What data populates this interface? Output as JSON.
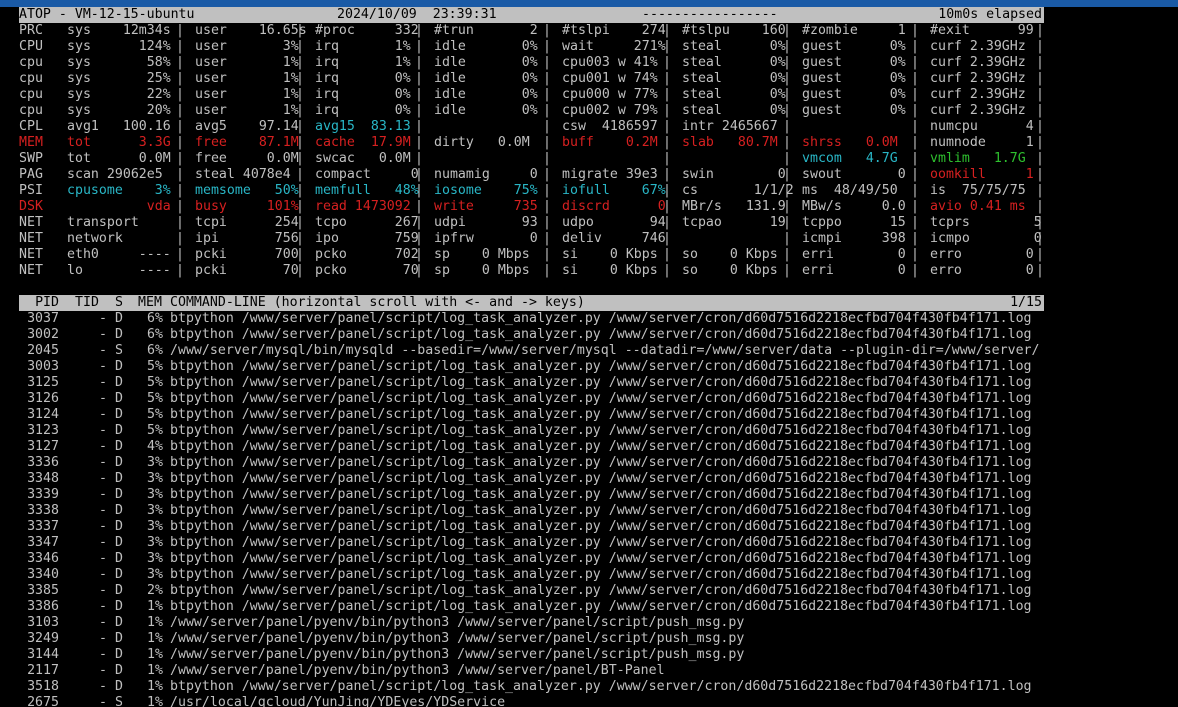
{
  "header": {
    "app": "ATOP - VM-12-15-ubuntu",
    "datetime": "2024/10/09  23:39:31",
    "dashes": "-----------------",
    "elapsed": "10m0s elapsed"
  },
  "stats": [
    {
      "cls": "",
      "label": "PRC",
      "cols": [
        {
          "t": "sys    12m34s"
        },
        {
          "t": "user    16.65s"
        },
        {
          "t": "#proc     332"
        },
        {
          "t": "#trun       2"
        },
        {
          "t": "#tslpi    274"
        },
        {
          "t": "#tslpu    160"
        },
        {
          "t": "#zombie     1"
        },
        {
          "t": "#exit      99"
        }
      ]
    },
    {
      "cls": "",
      "label": "CPU",
      "cols": [
        {
          "t": "sys      124%"
        },
        {
          "t": "user       3%"
        },
        {
          "t": "irq       1%"
        },
        {
          "t": "idle       0%"
        },
        {
          "t": "wait     271%"
        },
        {
          "t": "steal      0%"
        },
        {
          "t": "guest      0%"
        },
        {
          "t": "curf 2.39GHz"
        }
      ]
    },
    {
      "cls": "",
      "label": "cpu",
      "cols": [
        {
          "t": "sys       58%"
        },
        {
          "t": "user       1%"
        },
        {
          "t": "irq       1%"
        },
        {
          "t": "idle       0%"
        },
        {
          "t": "cpu003 w 41%"
        },
        {
          "t": "steal      0%"
        },
        {
          "t": "guest      0%"
        },
        {
          "t": "curf 2.39GHz"
        }
      ]
    },
    {
      "cls": "",
      "label": "cpu",
      "cols": [
        {
          "t": "sys       25%"
        },
        {
          "t": "user       1%"
        },
        {
          "t": "irq       0%"
        },
        {
          "t": "idle       0%"
        },
        {
          "t": "cpu001 w 74%"
        },
        {
          "t": "steal      0%"
        },
        {
          "t": "guest      0%"
        },
        {
          "t": "curf 2.39GHz"
        }
      ]
    },
    {
      "cls": "",
      "label": "cpu",
      "cols": [
        {
          "t": "sys       22%"
        },
        {
          "t": "user       1%"
        },
        {
          "t": "irq       0%"
        },
        {
          "t": "idle       0%"
        },
        {
          "t": "cpu000 w 77%"
        },
        {
          "t": "steal      0%"
        },
        {
          "t": "guest      0%"
        },
        {
          "t": "curf 2.39GHz"
        }
      ]
    },
    {
      "cls": "",
      "label": "cpu",
      "cols": [
        {
          "t": "sys       20%"
        },
        {
          "t": "user       1%"
        },
        {
          "t": "irq       0%"
        },
        {
          "t": "idle       0%"
        },
        {
          "t": "cpu002 w 79%"
        },
        {
          "t": "steal      0%"
        },
        {
          "t": "guest      0%"
        },
        {
          "t": "curf 2.39GHz"
        }
      ]
    },
    {
      "cls": "",
      "label": "CPL",
      "cols": [
        {
          "t": "avg1   100.16"
        },
        {
          "t": "avg5    97.14"
        },
        {
          "t": "avg15  83.13",
          "c": "cyan"
        },
        {
          "t": ""
        },
        {
          "t": "csw  4186597"
        },
        {
          "t": "intr 2465667"
        },
        {
          "t": ""
        },
        {
          "t": "numcpu      4"
        }
      ]
    },
    {
      "cls": "red",
      "label": "MEM",
      "cols": [
        {
          "t": "tot      3.3G",
          "c": "red"
        },
        {
          "t": "free    87.1M",
          "c": "red"
        },
        {
          "t": "cache  17.9M",
          "c": "red"
        },
        {
          "t": "dirty   0.0M"
        },
        {
          "t": "buff    0.2M",
          "c": "red"
        },
        {
          "t": "slab   80.7M",
          "c": "red"
        },
        {
          "t": "shrss   0.0M",
          "c": "red"
        },
        {
          "t": "numnode     1"
        }
      ]
    },
    {
      "cls": "",
      "label": "SWP",
      "cols": [
        {
          "t": "tot      0.0M"
        },
        {
          "t": "free     0.0M"
        },
        {
          "t": "swcac   0.0M"
        },
        {
          "t": ""
        },
        {
          "t": ""
        },
        {
          "t": ""
        },
        {
          "t": "vmcom   4.7G",
          "c": "cyan"
        },
        {
          "t": "vmlim   1.7G",
          "c": "green"
        }
      ]
    },
    {
      "cls": "",
      "label": "PAG",
      "cols": [
        {
          "t": "scan 29062e5"
        },
        {
          "t": "steal 4078e4"
        },
        {
          "t": "compact     0"
        },
        {
          "t": "numamig     0"
        },
        {
          "t": "migrate 39e3"
        },
        {
          "t": "swin        0"
        },
        {
          "t": "swout       0"
        },
        {
          "t": "oomkill     1",
          "c": "red"
        }
      ]
    },
    {
      "cls": "",
      "label": "PSI",
      "cols": [
        {
          "t": "cpusome    3%",
          "c": "cyan"
        },
        {
          "t": "memsome   50%",
          "c": "cyan"
        },
        {
          "t": "memfull   48%",
          "c": "cyan"
        },
        {
          "t": "iosome    75%",
          "c": "cyan"
        },
        {
          "t": "iofull    67%",
          "c": "cyan"
        },
        {
          "t": "cs       1/1/2"
        },
        {
          "t": "ms  48/49/50"
        },
        {
          "t": "is  75/75/75"
        }
      ]
    },
    {
      "cls": "red",
      "label": "DSK",
      "cols": [
        {
          "t": "          vda",
          "c": "red"
        },
        {
          "t": "busy     101%",
          "c": "red"
        },
        {
          "t": "read 1473092",
          "c": "red"
        },
        {
          "t": "write     735",
          "c": "red"
        },
        {
          "t": "discrd      0",
          "c": "red"
        },
        {
          "t": "MBr/s   131.9"
        },
        {
          "t": "MBw/s     0.0"
        },
        {
          "t": "avio 0.41 ms",
          "c": "red"
        }
      ]
    },
    {
      "cls": "",
      "label": "NET",
      "cols": [
        {
          "t": "transport"
        },
        {
          "t": "tcpi      254"
        },
        {
          "t": "tcpo      267"
        },
        {
          "t": "udpi       93"
        },
        {
          "t": "udpo       94"
        },
        {
          "t": "tcpao      19"
        },
        {
          "t": "tcppo      15"
        },
        {
          "t": "tcprs        5"
        }
      ]
    },
    {
      "cls": "",
      "label": "NET",
      "cols": [
        {
          "t": "network"
        },
        {
          "t": "ipi       756"
        },
        {
          "t": "ipo       759"
        },
        {
          "t": "ipfrw       0"
        },
        {
          "t": "deliv     746"
        },
        {
          "t": ""
        },
        {
          "t": "icmpi     398"
        },
        {
          "t": "icmpo        0"
        }
      ]
    },
    {
      "cls": "",
      "label": "NET",
      "cols": [
        {
          "t": "eth0     ----"
        },
        {
          "t": "pcki      700"
        },
        {
          "t": "pcko      702"
        },
        {
          "t": "sp    0 Mbps"
        },
        {
          "t": "si    0 Kbps"
        },
        {
          "t": "so    0 Kbps"
        },
        {
          "t": "erri        0"
        },
        {
          "t": "erro        0"
        }
      ]
    },
    {
      "cls": "",
      "label": "NET",
      "cols": [
        {
          "t": "lo       ----"
        },
        {
          "t": "pcki       70"
        },
        {
          "t": "pcko       70"
        },
        {
          "t": "sp    0 Mbps"
        },
        {
          "t": "si    0 Kbps"
        },
        {
          "t": "so    0 Kbps"
        },
        {
          "t": "erri        0"
        },
        {
          "t": "erro        0"
        }
      ]
    }
  ],
  "process_table": {
    "header": {
      "pid": "PID",
      "tid": "TID",
      "s": "S",
      "mem": "MEM",
      "cmd": "COMMAND-LINE (horizontal scroll with <- and -> keys)",
      "page": "1/15"
    },
    "rows": [
      {
        "pid": "3037",
        "tid": "-",
        "s": "D",
        "mem": "6%",
        "cmd": "btpython /www/server/panel/script/log_task_analyzer.py /www/server/cron/d60d7516d2218ecfbd704f430fb4f171.log"
      },
      {
        "pid": "3002",
        "tid": "-",
        "s": "D",
        "mem": "6%",
        "cmd": "btpython /www/server/panel/script/log_task_analyzer.py /www/server/cron/d60d7516d2218ecfbd704f430fb4f171.log"
      },
      {
        "pid": "2045",
        "tid": "-",
        "s": "S",
        "mem": "6%",
        "cmd": "/www/server/mysql/bin/mysqld --basedir=/www/server/mysql --datadir=/www/server/data --plugin-dir=/www/server/"
      },
      {
        "pid": "3003",
        "tid": "-",
        "s": "D",
        "mem": "5%",
        "cmd": "btpython /www/server/panel/script/log_task_analyzer.py /www/server/cron/d60d7516d2218ecfbd704f430fb4f171.log"
      },
      {
        "pid": "3125",
        "tid": "-",
        "s": "D",
        "mem": "5%",
        "cmd": "btpython /www/server/panel/script/log_task_analyzer.py /www/server/cron/d60d7516d2218ecfbd704f430fb4f171.log"
      },
      {
        "pid": "3126",
        "tid": "-",
        "s": "D",
        "mem": "5%",
        "cmd": "btpython /www/server/panel/script/log_task_analyzer.py /www/server/cron/d60d7516d2218ecfbd704f430fb4f171.log"
      },
      {
        "pid": "3124",
        "tid": "-",
        "s": "D",
        "mem": "5%",
        "cmd": "btpython /www/server/panel/script/log_task_analyzer.py /www/server/cron/d60d7516d2218ecfbd704f430fb4f171.log"
      },
      {
        "pid": "3123",
        "tid": "-",
        "s": "D",
        "mem": "5%",
        "cmd": "btpython /www/server/panel/script/log_task_analyzer.py /www/server/cron/d60d7516d2218ecfbd704f430fb4f171.log"
      },
      {
        "pid": "3127",
        "tid": "-",
        "s": "D",
        "mem": "4%",
        "cmd": "btpython /www/server/panel/script/log_task_analyzer.py /www/server/cron/d60d7516d2218ecfbd704f430fb4f171.log"
      },
      {
        "pid": "3336",
        "tid": "-",
        "s": "D",
        "mem": "3%",
        "cmd": "btpython /www/server/panel/script/log_task_analyzer.py /www/server/cron/d60d7516d2218ecfbd704f430fb4f171.log"
      },
      {
        "pid": "3348",
        "tid": "-",
        "s": "D",
        "mem": "3%",
        "cmd": "btpython /www/server/panel/script/log_task_analyzer.py /www/server/cron/d60d7516d2218ecfbd704f430fb4f171.log"
      },
      {
        "pid": "3339",
        "tid": "-",
        "s": "D",
        "mem": "3%",
        "cmd": "btpython /www/server/panel/script/log_task_analyzer.py /www/server/cron/d60d7516d2218ecfbd704f430fb4f171.log"
      },
      {
        "pid": "3338",
        "tid": "-",
        "s": "D",
        "mem": "3%",
        "cmd": "btpython /www/server/panel/script/log_task_analyzer.py /www/server/cron/d60d7516d2218ecfbd704f430fb4f171.log"
      },
      {
        "pid": "3337",
        "tid": "-",
        "s": "D",
        "mem": "3%",
        "cmd": "btpython /www/server/panel/script/log_task_analyzer.py /www/server/cron/d60d7516d2218ecfbd704f430fb4f171.log"
      },
      {
        "pid": "3347",
        "tid": "-",
        "s": "D",
        "mem": "3%",
        "cmd": "btpython /www/server/panel/script/log_task_analyzer.py /www/server/cron/d60d7516d2218ecfbd704f430fb4f171.log"
      },
      {
        "pid": "3346",
        "tid": "-",
        "s": "D",
        "mem": "3%",
        "cmd": "btpython /www/server/panel/script/log_task_analyzer.py /www/server/cron/d60d7516d2218ecfbd704f430fb4f171.log"
      },
      {
        "pid": "3340",
        "tid": "-",
        "s": "D",
        "mem": "3%",
        "cmd": "btpython /www/server/panel/script/log_task_analyzer.py /www/server/cron/d60d7516d2218ecfbd704f430fb4f171.log"
      },
      {
        "pid": "3385",
        "tid": "-",
        "s": "D",
        "mem": "2%",
        "cmd": "btpython /www/server/panel/script/log_task_analyzer.py /www/server/cron/d60d7516d2218ecfbd704f430fb4f171.log"
      },
      {
        "pid": "3386",
        "tid": "-",
        "s": "D",
        "mem": "1%",
        "cmd": "btpython /www/server/panel/script/log_task_analyzer.py /www/server/cron/d60d7516d2218ecfbd704f430fb4f171.log"
      },
      {
        "pid": "3103",
        "tid": "-",
        "s": "D",
        "mem": "1%",
        "cmd": "/www/server/panel/pyenv/bin/python3 /www/server/panel/script/push_msg.py"
      },
      {
        "pid": "3249",
        "tid": "-",
        "s": "D",
        "mem": "1%",
        "cmd": "/www/server/panel/pyenv/bin/python3 /www/server/panel/script/push_msg.py"
      },
      {
        "pid": "3144",
        "tid": "-",
        "s": "D",
        "mem": "1%",
        "cmd": "/www/server/panel/pyenv/bin/python3 /www/server/panel/script/push_msg.py"
      },
      {
        "pid": "2117",
        "tid": "-",
        "s": "D",
        "mem": "1%",
        "cmd": "/www/server/panel/pyenv/bin/python3 /www/server/panel/BT-Panel"
      },
      {
        "pid": "3518",
        "tid": "-",
        "s": "D",
        "mem": "1%",
        "cmd": "btpython /www/server/panel/script/log_task_analyzer.py /www/server/cron/d60d7516d2218ecfbd704f430fb4f171.log"
      },
      {
        "pid": "2675",
        "tid": "-",
        "s": "S",
        "mem": "1%",
        "cmd": "/usr/local/qcloud/YunJing/YDEyes/YDService"
      }
    ]
  }
}
